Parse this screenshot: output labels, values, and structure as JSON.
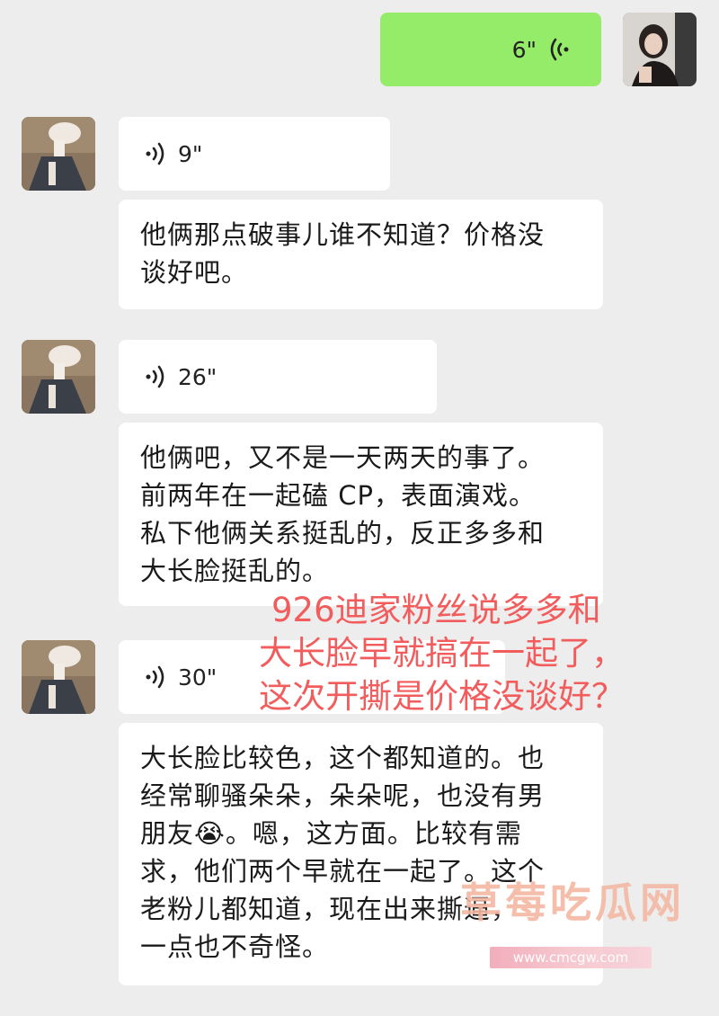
{
  "messages": {
    "m1": {
      "sender": "self",
      "duration": "6\""
    },
    "m2": {
      "sender": "other",
      "duration": "9\""
    },
    "m3": {
      "sender": "other",
      "text_lines": [
        "他俩那点破事儿谁不知道？价格没",
        "谈好吧。"
      ]
    },
    "m4": {
      "sender": "other",
      "duration": "26\""
    },
    "m5": {
      "sender": "other",
      "text_lines": [
        "他俩吧，又不是一天两天的事了。",
        "前两年在一起磕 CP，表面演戏。",
        "私下他俩关系挺乱的，反正多多和",
        "大长脸挺乱的。"
      ]
    },
    "m6": {
      "sender": "other",
      "duration": "30\""
    },
    "m7": {
      "sender": "other",
      "text_lines": [
        "大长脸比较色，这个都知道的。也",
        "经常聊骚朵朵，朵朵呢，也没有男",
        "朋友😭。嗯，这方面。比较有需",
        "求，他们两个早就在一起了。这个",
        "老粉儿都知道，现在出来撕逼，",
        "一点也不奇怪。"
      ]
    }
  },
  "overlay": {
    "lines": [
      "926迪家粉丝说多多和",
      "大长脸早就搞在一起了，",
      "这次开撕是价格没谈好？"
    ],
    "color": "#f25c5c"
  },
  "watermark": {
    "text": "草莓吃瓜网",
    "url": "www.cmcgw.com"
  },
  "colors": {
    "self_bubble": "#95ec69",
    "other_bubble": "#ffffff",
    "background": "#ededed"
  }
}
